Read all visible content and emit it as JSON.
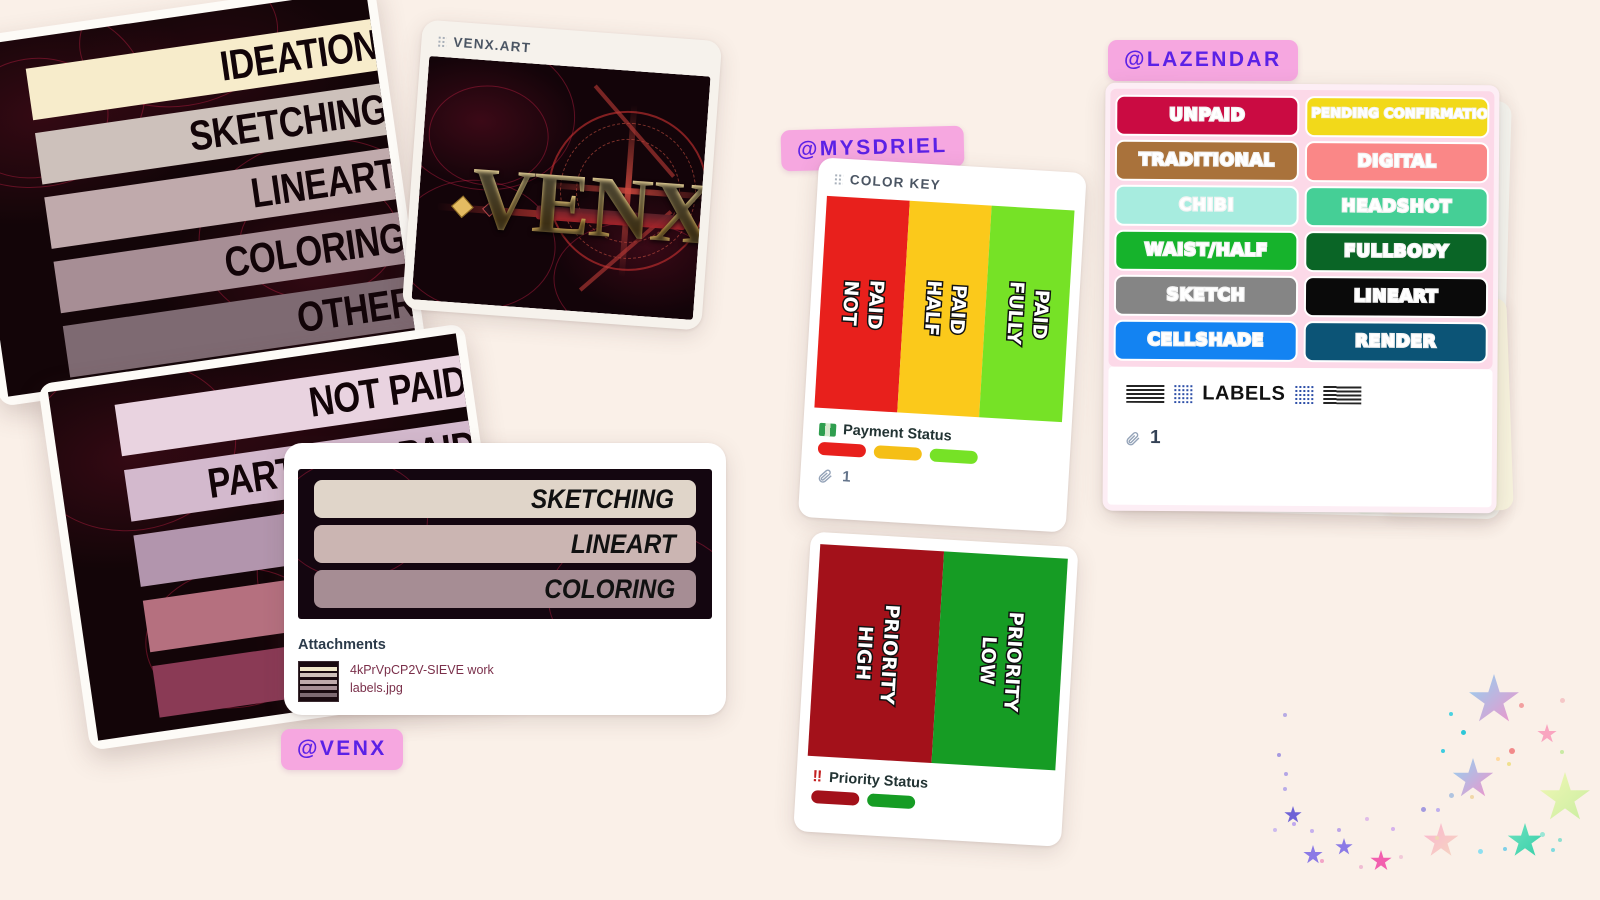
{
  "page": {
    "background": "#faf0e8"
  },
  "workflow_card": {
    "name": "workflow-stages-photo",
    "rows": [
      {
        "label": "IDEATION",
        "color": "#f7eccb"
      },
      {
        "label": "SKETCHING",
        "color": "#cdc1bb"
      },
      {
        "label": "LINEART",
        "color": "#c0aaac"
      },
      {
        "label": "COLORING",
        "color": "#a78e95"
      },
      {
        "label": "OTHER",
        "color": "#7e6a72"
      }
    ]
  },
  "payment_card": {
    "name": "payment-stages-photo",
    "rows": [
      {
        "label": "NOT PAID",
        "color": "#e9d3e0"
      },
      {
        "label": "PARTIALLY PAID",
        "color": "#d3b9cd"
      },
      {
        "label": "",
        "color": "#b295ad"
      },
      {
        "label": "",
        "color": "#b5707f"
      },
      {
        "label": "",
        "color": "#8a3a55"
      }
    ]
  },
  "venx_art_card": {
    "header": "VENX.ART",
    "artwork_title": "VENX"
  },
  "venx_card": {
    "handle": "@VENX",
    "preview_rows": [
      {
        "label": "SKETCHING",
        "color": "#e0d5c9"
      },
      {
        "label": "LINEART",
        "color": "#cbb5b2"
      },
      {
        "label": "COLORING",
        "color": "#a68d94"
      }
    ],
    "attachments_label": "Attachments",
    "attachment_file": "4kPrVpCP2V-SIEVE work labels.jpg"
  },
  "mysdriel_card": {
    "handle": "@MYSDRIEL",
    "header": "COLOR KEY",
    "payment": {
      "columns": [
        {
          "words": [
            "NOT",
            "PAID"
          ],
          "color": "#e8201c"
        },
        {
          "words": [
            "HALF",
            "PAID"
          ],
          "color": "#fbc91b"
        },
        {
          "words": [
            "FULLY",
            "PAID"
          ],
          "color": "#76e226"
        }
      ],
      "label_icon": "money-icon",
      "label": "Payment Status",
      "chips": [
        "#e8201c",
        "#f5bf16",
        "#76e226"
      ],
      "attachment_count": "1"
    },
    "priority": {
      "columns": [
        {
          "words": [
            "HIGH",
            "PRIORITY"
          ],
          "color": "#a3111a"
        },
        {
          "words": [
            "LOW",
            "PRIORITY"
          ],
          "color": "#169c24"
        }
      ],
      "label_icon": "double-exclamation-icon",
      "label": "Priority Status",
      "chips": [
        "#a3111a",
        "#169c24"
      ]
    }
  },
  "lazendar_card": {
    "handle": "@LAZENDAR",
    "pills": [
      {
        "label": "UNPAID",
        "color": "#ca0b42",
        "small": false
      },
      {
        "label": "PENDING CONFIRMATION",
        "color": "#f2d91a",
        "small": true
      },
      {
        "label": "TRADITIONAL",
        "color": "#a9723b",
        "small": false
      },
      {
        "label": "DIGITAL",
        "color": "#fa8787",
        "small": false
      },
      {
        "label": "CHIBI",
        "color": "#a7ecdf",
        "small": false
      },
      {
        "label": "HEADSHOT",
        "color": "#45cf96",
        "small": false
      },
      {
        "label": "WAIST/HALF",
        "color": "#16b32c",
        "small": false
      },
      {
        "label": "FULLBODY",
        "color": "#0a6526",
        "small": false
      },
      {
        "label": "SKETCH",
        "color": "#858585",
        "small": false
      },
      {
        "label": "LINEART",
        "color": "#0a0a0a",
        "small": false
      },
      {
        "label": "CELLSHADE",
        "color": "#1383f2",
        "small": false
      },
      {
        "label": "RENDER",
        "color": "#0c5476",
        "small": false
      }
    ],
    "labels_title": "LABELS",
    "attachment_count": "1"
  }
}
